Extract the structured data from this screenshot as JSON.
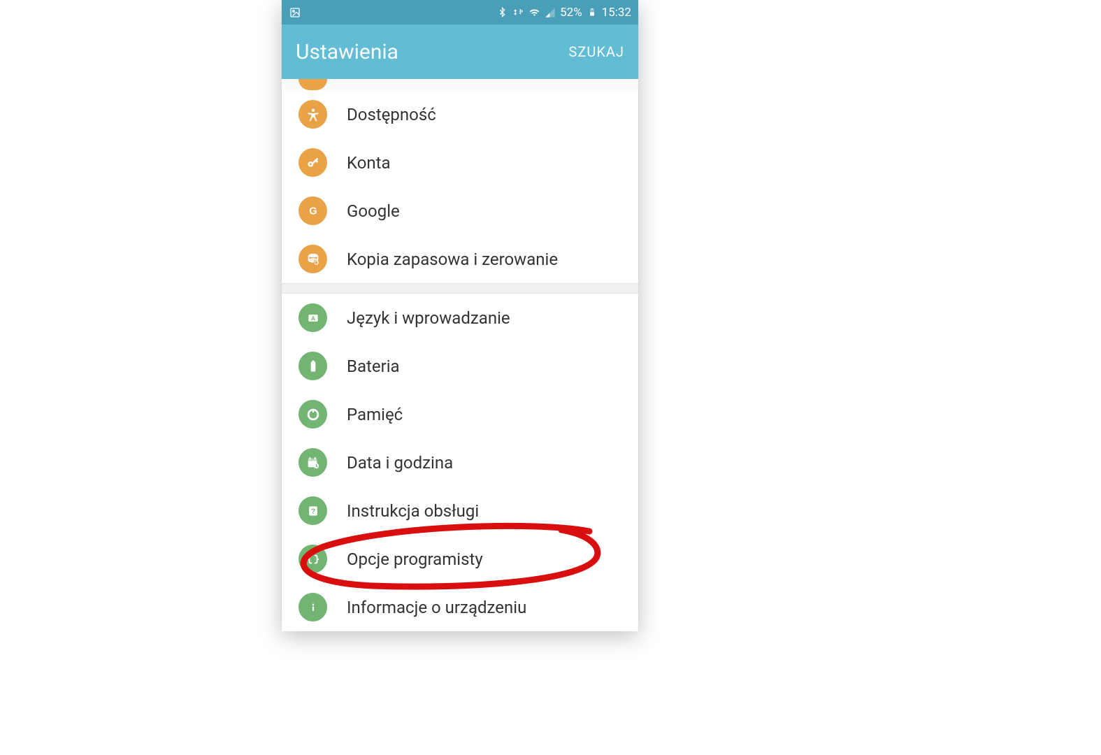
{
  "status_bar": {
    "battery_pct": "52%",
    "time": "15:32"
  },
  "header": {
    "title": "Ustawienia",
    "search_label": "SZUKAJ"
  },
  "groups": [
    {
      "color": "orange",
      "items": [
        {
          "icon": "accessibility-icon",
          "label": "Dostępność"
        },
        {
          "icon": "key-icon",
          "label": "Konta"
        },
        {
          "icon": "google-icon",
          "label": "Google"
        },
        {
          "icon": "backup-icon",
          "label": "Kopia zapasowa i zerowanie"
        }
      ]
    },
    {
      "color": "green",
      "items": [
        {
          "icon": "keyboard-icon",
          "label": "Język i wprowadzanie"
        },
        {
          "icon": "battery-icon",
          "label": "Bateria"
        },
        {
          "icon": "storage-icon",
          "label": "Pamięć"
        },
        {
          "icon": "date-icon",
          "label": "Data i godzina"
        },
        {
          "icon": "help-icon",
          "label": "Instrukcja obsługi"
        },
        {
          "icon": "dev-icon",
          "label": "Opcje programisty"
        },
        {
          "icon": "info-icon",
          "label": "Informacje o urządzeniu"
        }
      ]
    }
  ],
  "highlighted_item_label": "Opcje programisty"
}
